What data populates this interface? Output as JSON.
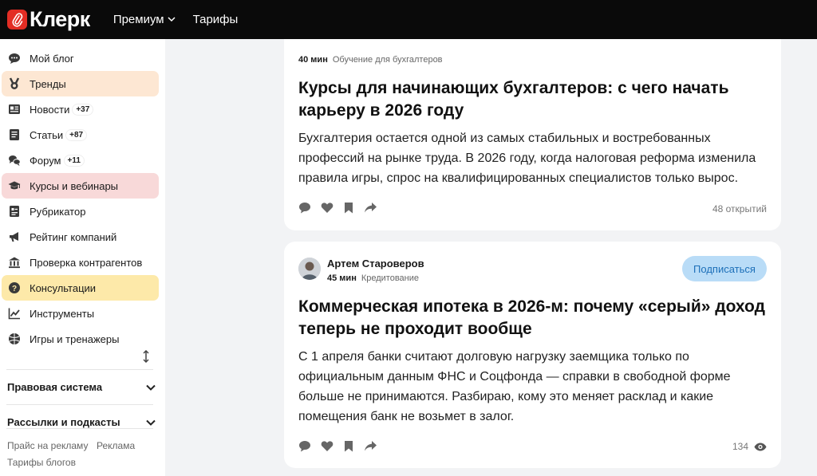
{
  "header": {
    "logo_text": "Клерк",
    "nav": [
      {
        "label": "Премиум"
      },
      {
        "label": "Тарифы"
      }
    ]
  },
  "sidebar": {
    "items": [
      {
        "label": "Мой блог",
        "icon": "chat-icon",
        "badge": ""
      },
      {
        "label": "Тренды",
        "icon": "medal-icon",
        "badge": ""
      },
      {
        "label": "Новости",
        "icon": "newspaper-icon",
        "badge": "+37"
      },
      {
        "label": "Статьи",
        "icon": "article-icon",
        "badge": "+87"
      },
      {
        "label": "Форум",
        "icon": "forum-icon",
        "badge": "+11"
      },
      {
        "label": "Курсы и вебинары",
        "icon": "graduation-cap-icon",
        "badge": ""
      },
      {
        "label": "Рубрикатор",
        "icon": "rubricator-icon",
        "badge": ""
      },
      {
        "label": "Рейтинг компаний",
        "icon": "megaphone-icon",
        "badge": ""
      },
      {
        "label": "Проверка контрагентов",
        "icon": "bank-icon",
        "badge": ""
      },
      {
        "label": "Консультации",
        "icon": "question-icon",
        "badge": ""
      },
      {
        "label": "Инструменты",
        "icon": "chart-line-icon",
        "badge": ""
      },
      {
        "label": "Игры и тренажеры",
        "icon": "ball-icon",
        "badge": ""
      }
    ],
    "sections": [
      {
        "label": "Правовая система"
      },
      {
        "label": "Рассылки и подкасты"
      }
    ],
    "footer_links": [
      "Прайс на рекламу",
      "Реклама",
      "Тарифы блогов"
    ]
  },
  "posts": [
    {
      "read_time": "40 мин",
      "category": "Обучение для бухгалтеров",
      "title_lines": [
        "Курсы для начинающих бухгалтеров: с чего начать",
        "карьеру в 2026 году"
      ],
      "text_lines": [
        "Бухгалтерия остается одной из самых стабильных и востребованных",
        "профессий на рынке труда. В 2026 году, когда налоговая реформа изменила",
        "правила игры, спрос на квалифицированных специалистов только вырос."
      ],
      "stat": "48 открытий"
    },
    {
      "author": "Артем Староверов",
      "read_time": "45 мин",
      "category": "Кредитование",
      "subscribe_label": "Подписаться",
      "title_lines": [
        "Коммерческая ипотека в 2026-м: почему «серый» доход",
        "теперь не проходит вообще"
      ],
      "text_lines": [
        "С 1 апреля банки считают долговую нагрузку заемщика только по",
        "официальным данным ФНС и Соцфонда — справки в свободной форме",
        "больше не принимаются. Разбираю, кому это меняет расклад и какие",
        "помещения банк не возьмет в залог."
      ],
      "stat": "134"
    }
  ],
  "colors": {
    "brand_red": "#e32d24",
    "highlight_orange": "#fde7d3",
    "highlight_red": "#f8d9d9",
    "highlight_yellow": "#fde9a9",
    "subscribe_bg": "#b9dcf7"
  }
}
